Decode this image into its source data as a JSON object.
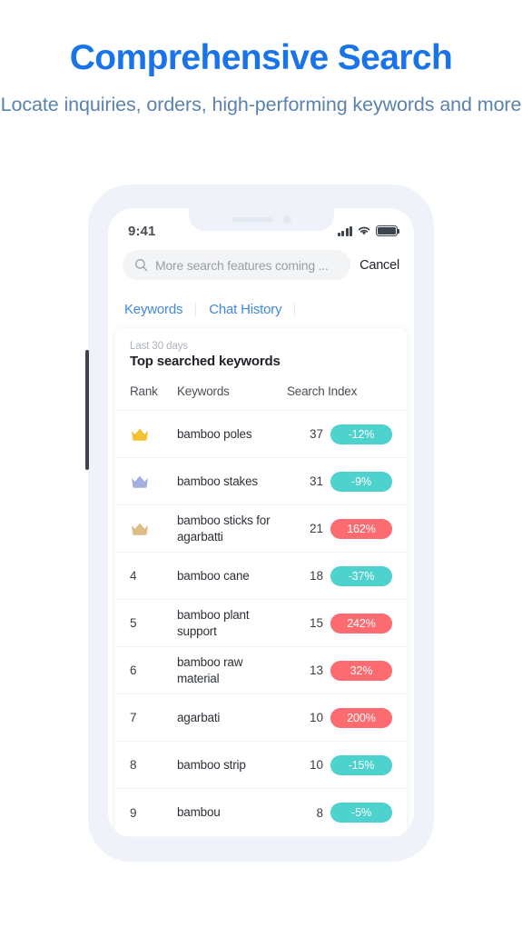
{
  "hero": {
    "title": "Comprehensive Search",
    "subtitle": "Locate inquiries, orders, high-performing keywords and more",
    "title_color": "#1874E8",
    "subtitle_color": "#5A82AE"
  },
  "phone": {
    "status_bar": {
      "time": "9:41",
      "signal_icon": "signal-bars-icon",
      "wifi_icon": "wifi-icon",
      "battery_icon": "battery-icon"
    },
    "search": {
      "icon": "search-icon",
      "placeholder": "More search features coming ...",
      "value": "",
      "cancel_label": "Cancel"
    },
    "tabs": [
      {
        "label": "Keywords",
        "selected": true
      },
      {
        "label": "Chat History",
        "selected": false
      }
    ],
    "card": {
      "period": "Last 30 days",
      "title": "Top searched keywords",
      "columns": {
        "rank": "Rank",
        "keywords": "Keywords",
        "search_index": "Search Index"
      },
      "rows": [
        {
          "rank": "1",
          "rank_icon": "crown-gold-icon",
          "crown_color": "#F5C131",
          "keyword": "bamboo poles",
          "index": "37",
          "change": "-12%",
          "direction": "down"
        },
        {
          "rank": "2",
          "rank_icon": "crown-silver-icon",
          "crown_color": "#A2AFDF",
          "keyword": "bamboo stakes",
          "index": "31",
          "change": "-9%",
          "direction": "down"
        },
        {
          "rank": "3",
          "rank_icon": "crown-bronze-icon",
          "crown_color": "#DDBC85",
          "keyword": "bamboo sticks for agarbatti",
          "index": "21",
          "change": "162%",
          "direction": "up"
        },
        {
          "rank": "4",
          "rank_icon": "",
          "crown_color": "",
          "keyword": "bamboo cane",
          "index": "18",
          "change": "-37%",
          "direction": "down"
        },
        {
          "rank": "5",
          "rank_icon": "",
          "crown_color": "",
          "keyword": "bamboo plant support",
          "index": "15",
          "change": "242%",
          "direction": "up"
        },
        {
          "rank": "6",
          "rank_icon": "",
          "crown_color": "",
          "keyword": "bamboo raw material",
          "index": "13",
          "change": "32%",
          "direction": "up"
        },
        {
          "rank": "7",
          "rank_icon": "",
          "crown_color": "",
          "keyword": "agarbati",
          "index": "10",
          "change": "200%",
          "direction": "up"
        },
        {
          "rank": "8",
          "rank_icon": "",
          "crown_color": "",
          "keyword": "bamboo strip",
          "index": "10",
          "change": "-15%",
          "direction": "down"
        },
        {
          "rank": "9",
          "rank_icon": "",
          "crown_color": "",
          "keyword": "bambou",
          "index": "8",
          "change": "-5%",
          "direction": "down"
        }
      ]
    }
  },
  "colors": {
    "badge_down": "#4ED2CE",
    "badge_up": "#FB6B6F",
    "phone_frame": "#EFF3F9"
  }
}
